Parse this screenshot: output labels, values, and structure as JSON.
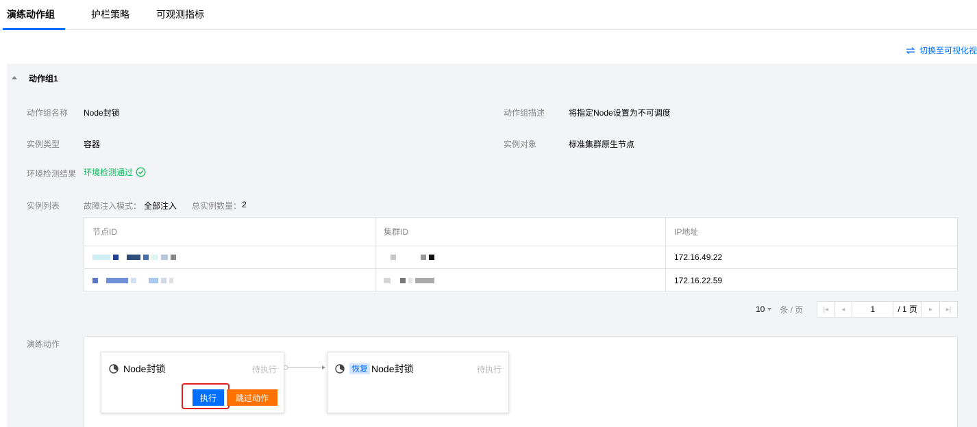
{
  "tabs": [
    {
      "label": "演练动作组",
      "active": true
    },
    {
      "label": "护栏策略",
      "active": false
    },
    {
      "label": "可观测指标",
      "active": false
    }
  ],
  "switch_view": {
    "icon": "swap-icon",
    "label": "切换至可视化视"
  },
  "group": {
    "title": "动作组1",
    "fields": {
      "name_label": "动作组名称",
      "name_value": "Node封锁",
      "desc_label": "动作组描述",
      "desc_value": "将指定Node设置为不可调度",
      "type_label": "实例类型",
      "type_value": "容器",
      "target_label": "实例对象",
      "target_value": "标准集群原生节点",
      "env_label": "环境检测结果",
      "env_value": "环境检测通过",
      "list_label": "实例列表",
      "mode_label": "故障注入模式：",
      "mode_value": "全部注入",
      "count_label": "总实例数量：",
      "count_value": "2",
      "actions_label": "演练动作"
    },
    "table": {
      "headers": [
        "节点ID",
        "集群ID",
        "IP地址"
      ],
      "rows": [
        {
          "node_id": "",
          "cluster_id": "",
          "ip": "172.16.49.22"
        },
        {
          "node_id": "",
          "cluster_id": "",
          "ip": "172.16.22.59"
        }
      ]
    },
    "pagination": {
      "page_size": "10",
      "unit": "条 / 页",
      "current_page": "1",
      "total_pages": "/ 1 页"
    },
    "flow": {
      "cards": [
        {
          "title": "Node封锁",
          "status": "待执行",
          "execute_label": "执行",
          "skip_label": "跳过动作"
        },
        {
          "tag": "恢复",
          "title": "Node封锁",
          "status": "待执行"
        }
      ]
    }
  },
  "colors": {
    "accent": "#006eff",
    "success": "#0abf5b",
    "warning": "#ff7200",
    "highlight": "#e02020"
  }
}
